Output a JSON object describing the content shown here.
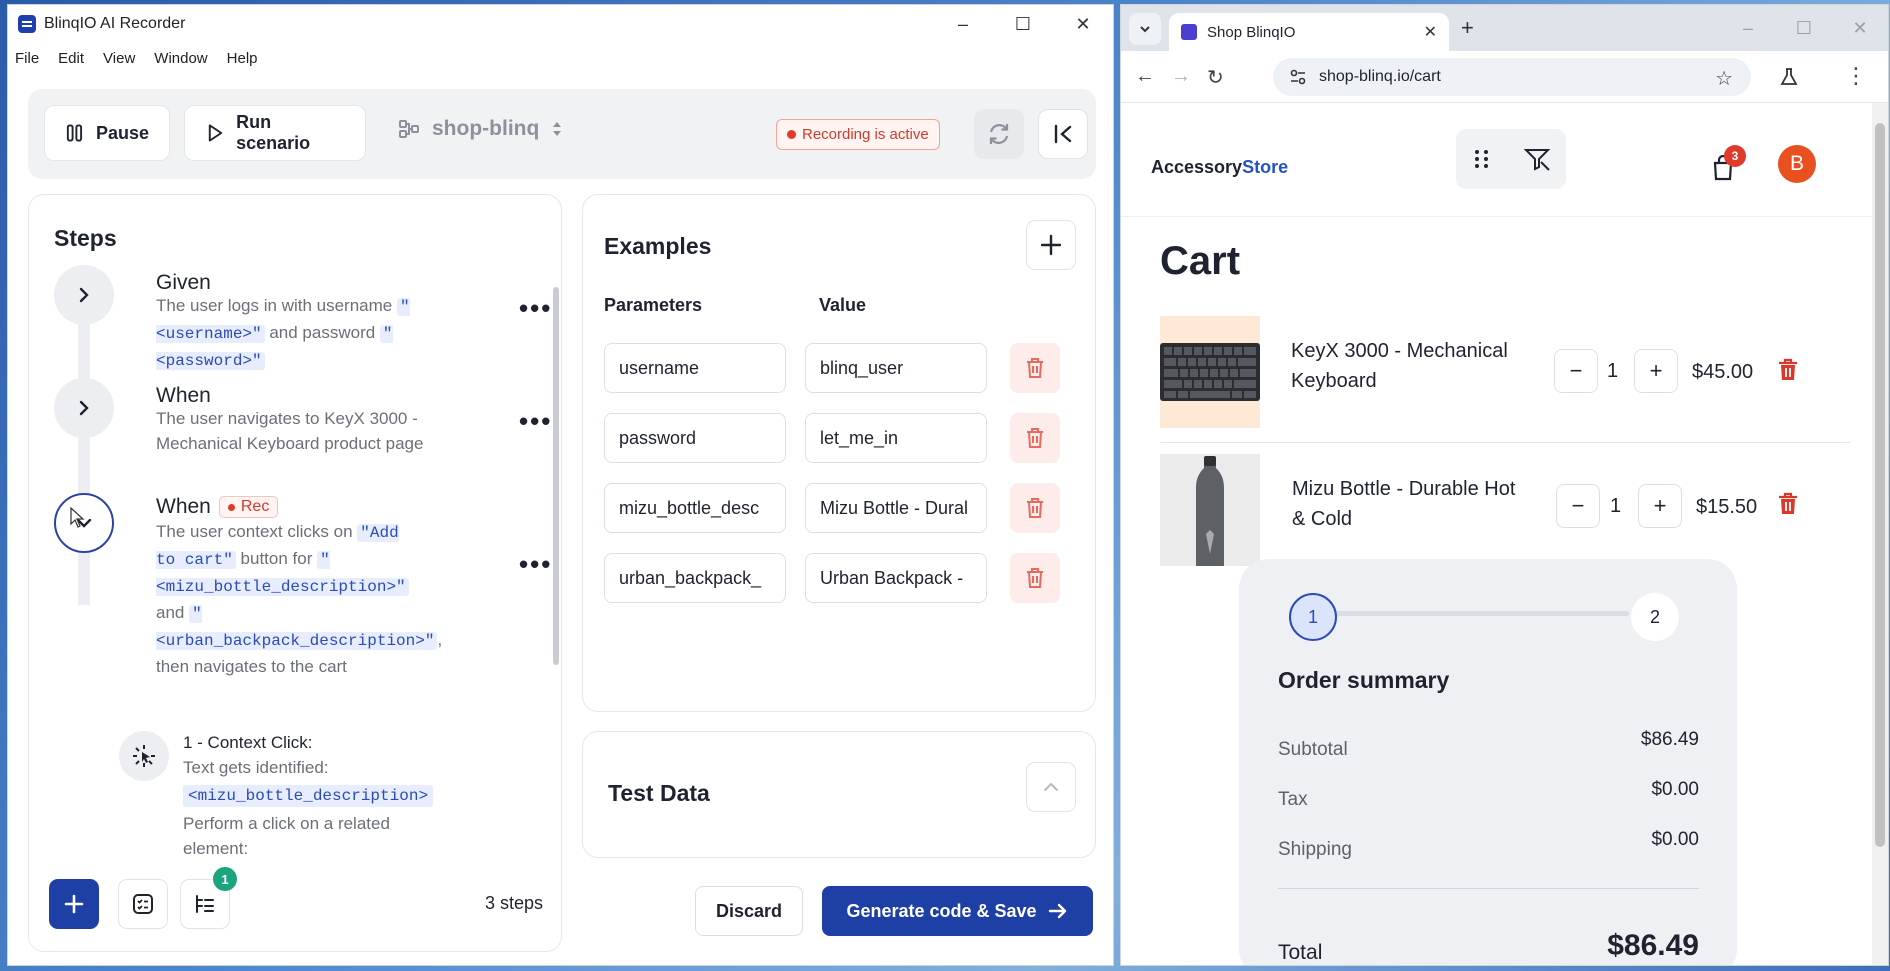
{
  "recorder": {
    "title": "BlinqIO AI Recorder",
    "menu": [
      "File",
      "Edit",
      "View",
      "Window",
      "Help"
    ],
    "toolbar": {
      "pause_label": "Pause",
      "run_label": "Run scenario",
      "project": "shop-blinq",
      "recording_status": "Recording is active"
    },
    "steps": {
      "title": "Steps",
      "items": [
        {
          "keyword": "Given",
          "text_a": "The user logs in with username ",
          "param_a": "\"<username>\"",
          "text_b": " and password ",
          "param_b": "\"<password>\""
        },
        {
          "keyword": "When",
          "text": "The user navigates to KeyX 3000 - Mechanical Keyboard product page"
        },
        {
          "keyword": "When",
          "rec": "Rec",
          "text_a": "The user context clicks on ",
          "param_a": "\"Add to cart\"",
          "text_b": " button for ",
          "param_b": "\"<mizu_bottle_description>\"",
          "text_c": " and ",
          "param_c": "\"<urban_backpack_description>\"",
          "text_d": ", then navigates to the cart"
        }
      ],
      "substep": {
        "heading": "1 - Context Click:",
        "line1": "Text gets identified:",
        "param": "<mizu_bottle_description>",
        "line2": "Perform a click on a related element:"
      },
      "count_label": "3 steps",
      "badge": "1"
    },
    "examples": {
      "title": "Examples",
      "col_param": "Parameters",
      "col_value": "Value",
      "rows": [
        {
          "param": "username",
          "value": "blinq_user"
        },
        {
          "param": "password",
          "value": "let_me_in"
        },
        {
          "param": "mizu_bottle_desc",
          "value": "Mizu Bottle - Dural"
        },
        {
          "param": "urban_backpack_",
          "value": "Urban Backpack -"
        }
      ]
    },
    "test_data": {
      "title": "Test Data"
    },
    "discard_label": "Discard",
    "generate_label": "Generate code & Save"
  },
  "browser": {
    "tab_title": "Shop BlinqIO",
    "url": "shop-blinq.io/cart",
    "site": {
      "logo_a": "Accessory",
      "logo_b": "Store",
      "cart_count": "3",
      "avatar": "B",
      "page_title": "Cart",
      "items": [
        {
          "name": "KeyX 3000 - Mechanical Keyboard",
          "qty": "1",
          "price": "$45.00"
        },
        {
          "name": "Mizu Bottle - Durable Hot & Cold",
          "qty": "1",
          "price": "$15.50"
        }
      ],
      "summary": {
        "step1": "1",
        "step2": "2",
        "title": "Order summary",
        "subtotal_label": "Subtotal",
        "subtotal": "$86.49",
        "tax_label": "Tax",
        "tax": "$0.00",
        "shipping_label": "Shipping",
        "shipping": "$0.00",
        "total_label": "Total",
        "total": "$86.49"
      }
    }
  },
  "colors": {
    "primary": "#1e3fa5",
    "recording": "#d03b2b",
    "param_bg": "#e7edfc",
    "delete_bg": "#fdecea"
  }
}
